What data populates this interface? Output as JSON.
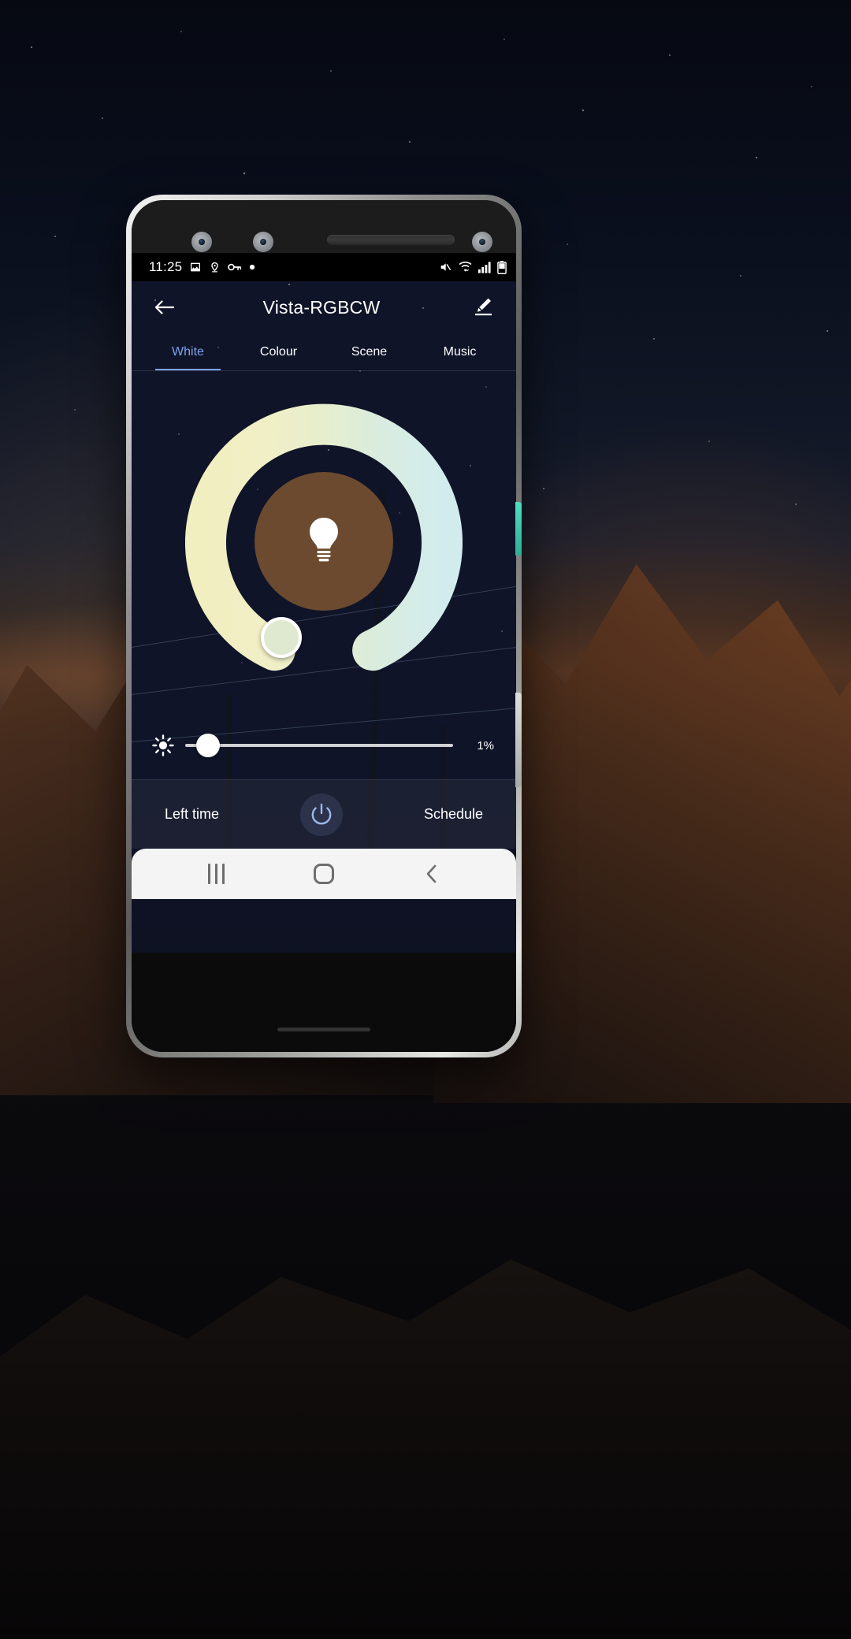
{
  "status_bar": {
    "time": "11:25",
    "left_icons": [
      "image-icon",
      "location-pin-icon",
      "key-icon",
      "dot-icon"
    ],
    "right_icons": [
      "mute-icon",
      "wifi-icon",
      "signal-bars-icon",
      "battery-icon"
    ]
  },
  "app_bar": {
    "back_icon": "back-arrow-icon",
    "title": "Vista-RGBCW",
    "edit_icon": "pencil-edit-icon"
  },
  "tabs": [
    {
      "label": "White",
      "active": true
    },
    {
      "label": "Colour",
      "active": false
    },
    {
      "label": "Scene",
      "active": false
    },
    {
      "label": "Music",
      "active": false
    }
  ],
  "colour_wheel": {
    "bulb_icon": "light-bulb-icon",
    "center_color": "#6b4a2f",
    "warm_color": "#f2efc0",
    "cool_color": "#d6ecef",
    "thumb_color": "#dfe9cf",
    "thumb_angle_deg": 232,
    "gap_bottom_deg": 90
  },
  "brightness": {
    "icon": "brightness-sun-icon",
    "value_label": "1%",
    "value": 1,
    "min": 0,
    "max": 100,
    "track_color": "#ffffff",
    "thumb_color": "#ffffff"
  },
  "bottom_bar": {
    "left_label": "Left time",
    "power_icon": "power-button-icon",
    "power_color": "#9cb8ea",
    "right_label": "Schedule"
  },
  "nav_bar": {
    "recents_icon": "recents-icon",
    "home_icon": "home-icon",
    "back_icon": "nav-back-icon"
  },
  "theme": {
    "accent": "#7ea2ec",
    "status_bar_bg": "#000000",
    "app_bg": "#16203c",
    "text": "#ffffff"
  }
}
